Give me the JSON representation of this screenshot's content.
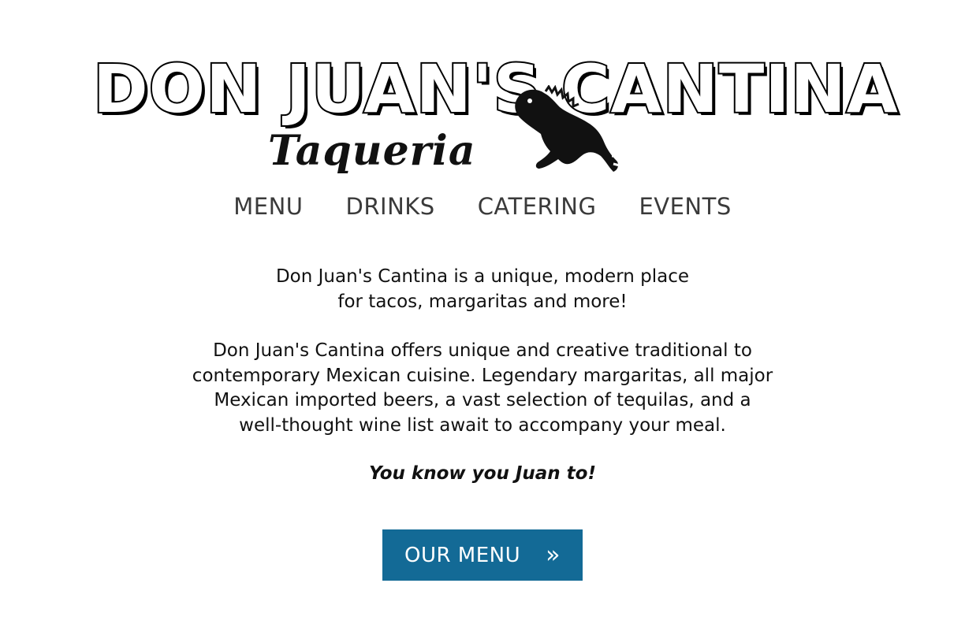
{
  "logo": {
    "title_left": "DON JUAN'S",
    "title_right": "CANTINA",
    "script": "Taqueria",
    "mascot_icon": "iguana-icon"
  },
  "nav": {
    "items": [
      {
        "label": "MENU"
      },
      {
        "label": "DRINKS"
      },
      {
        "label": "CATERING"
      },
      {
        "label": "EVENTS"
      }
    ]
  },
  "intro": {
    "line1": "Don Juan's Cantina is a unique, modern place",
    "line2": "for tacos, margaritas and more!"
  },
  "description": {
    "line1": "Don Juan's Cantina offers unique and creative traditional to",
    "line2": "contemporary Mexican cuisine. Legendary margaritas, all major",
    "line3": "Mexican imported beers, a vast selection of tequilas, and a",
    "line4": "well-thought wine list await to accompany your meal."
  },
  "tagline": "You know you Juan to!",
  "cta": {
    "label": "OUR MENU",
    "icon": "double-chevron-right-icon",
    "icon_glyph": "»",
    "color": "#136a96"
  }
}
